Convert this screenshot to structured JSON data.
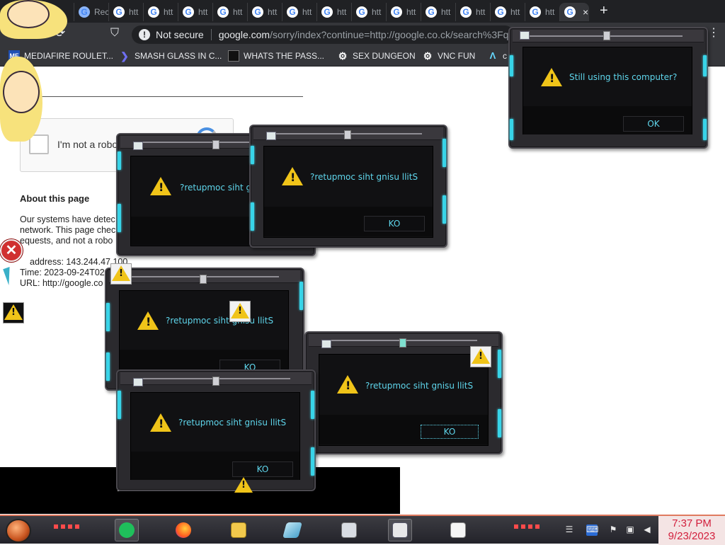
{
  "browser": {
    "tabs": [
      {
        "label": "Rec",
        "active": false
      },
      {
        "label": "htt",
        "active": false
      },
      {
        "label": "htt",
        "active": false
      },
      {
        "label": "htt",
        "active": false
      },
      {
        "label": "htt",
        "active": false
      },
      {
        "label": "htt",
        "active": false
      },
      {
        "label": "htt",
        "active": false
      },
      {
        "label": "htt",
        "active": false
      },
      {
        "label": "htt",
        "active": false
      },
      {
        "label": "htt",
        "active": false
      },
      {
        "label": "htt",
        "active": false
      },
      {
        "label": "htt",
        "active": false
      },
      {
        "label": "htt",
        "active": false
      },
      {
        "label": "htt",
        "active": false
      },
      {
        "label": "",
        "active": true
      }
    ],
    "tab_close": "×",
    "new_tab": "+",
    "address": {
      "security_label": "Not secure",
      "host": "google.com",
      "path": "/sorry/index?continue=http://google.co.ck/search%3Fq"
    },
    "bookmarks": [
      {
        "label": "MEDIAFIRE ROULET...",
        "icon": "mediafire-icon",
        "badge": "MF"
      },
      {
        "label": "SMASH GLASS IN C...",
        "icon": "angle-bracket-icon",
        "badge": ""
      },
      {
        "label": "WHATS THE PASS...",
        "icon": "dark-square-icon",
        "badge": ""
      },
      {
        "label": "SEX DUNGEON",
        "icon": "gear-icon",
        "badge": ""
      },
      {
        "label": "VNC FUN",
        "icon": "gear-icon",
        "badge": ""
      },
      {
        "label": "c",
        "icon": "lambda-icon",
        "badge": "Λ"
      }
    ]
  },
  "page": {
    "captcha_label": "I'm not a robo",
    "about_title": "About this page",
    "text_lines": [
      "Our systems have detec",
      "network. This page chec",
      "equests, and not a robo",
      "address: 143.244.47.100",
      "Time: 2023-09-24T02",
      "URL: http://google.co"
    ]
  },
  "dialogs": [
    {
      "id": "top-right",
      "message": "Still using this computer?",
      "button": "OK"
    },
    {
      "id": "back-left",
      "message": "?retupmoc siht gnisu",
      "button": ""
    },
    {
      "id": "upper-mid",
      "message": "?retupmoc siht gnisu llitS",
      "button": "KO"
    },
    {
      "id": "mid-left",
      "message": "?retupmoc siht gnisu llitS",
      "button": "KO"
    },
    {
      "id": "right",
      "message": "?retupmoc siht gnisu llitS",
      "button": "KO"
    },
    {
      "id": "bottom-left",
      "message": "?retupmoc siht gnisu llitS",
      "button": "KO"
    }
  ],
  "taskbar": {
    "time": "7:37 PM",
    "date": "9/23/2023",
    "accent": "#e07a5f",
    "clock_color": "#d21f3c"
  }
}
